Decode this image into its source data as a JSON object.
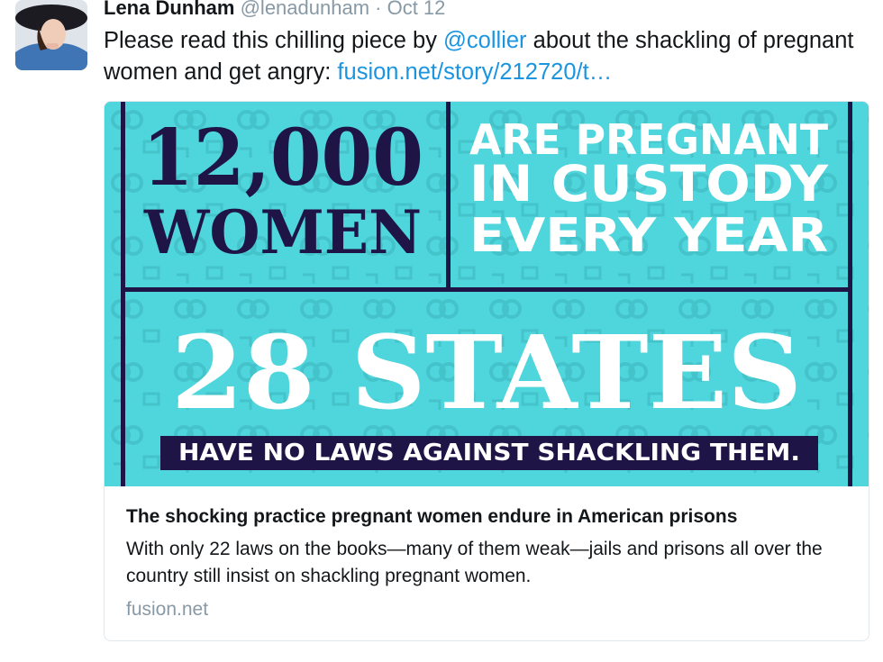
{
  "tweet": {
    "author_name": "Lena Dunham",
    "author_handle": "@lenadunham",
    "separator": " · ",
    "date": "Oct 12",
    "text_before": "Please read this chilling piece by ",
    "mention": "@collier",
    "text_after": " about the shackling of pregnant women and get angry: ",
    "link_text": "fusion.net/story/212720/t…"
  },
  "card": {
    "image": {
      "big_number": "12,000",
      "women": "WOMEN",
      "line1": "ARE PREGNANT",
      "line2": "IN CUSTODY",
      "line3": "EVERY YEAR",
      "states": "28 STATES",
      "banner": "HAVE NO LAWS AGAINST SHACKLING THEM."
    },
    "title": "The shocking practice pregnant women endure in American prisons",
    "description": "With only 22 laws on the books—many of them weak—jails and prisons all over the country still insist on shackling pregnant women.",
    "domain": "fusion.net"
  },
  "colors": {
    "link": "#1b95e0",
    "infographic_bg": "#4fd5dc",
    "infographic_navy": "#1e1446",
    "muted": "#8899a6"
  }
}
